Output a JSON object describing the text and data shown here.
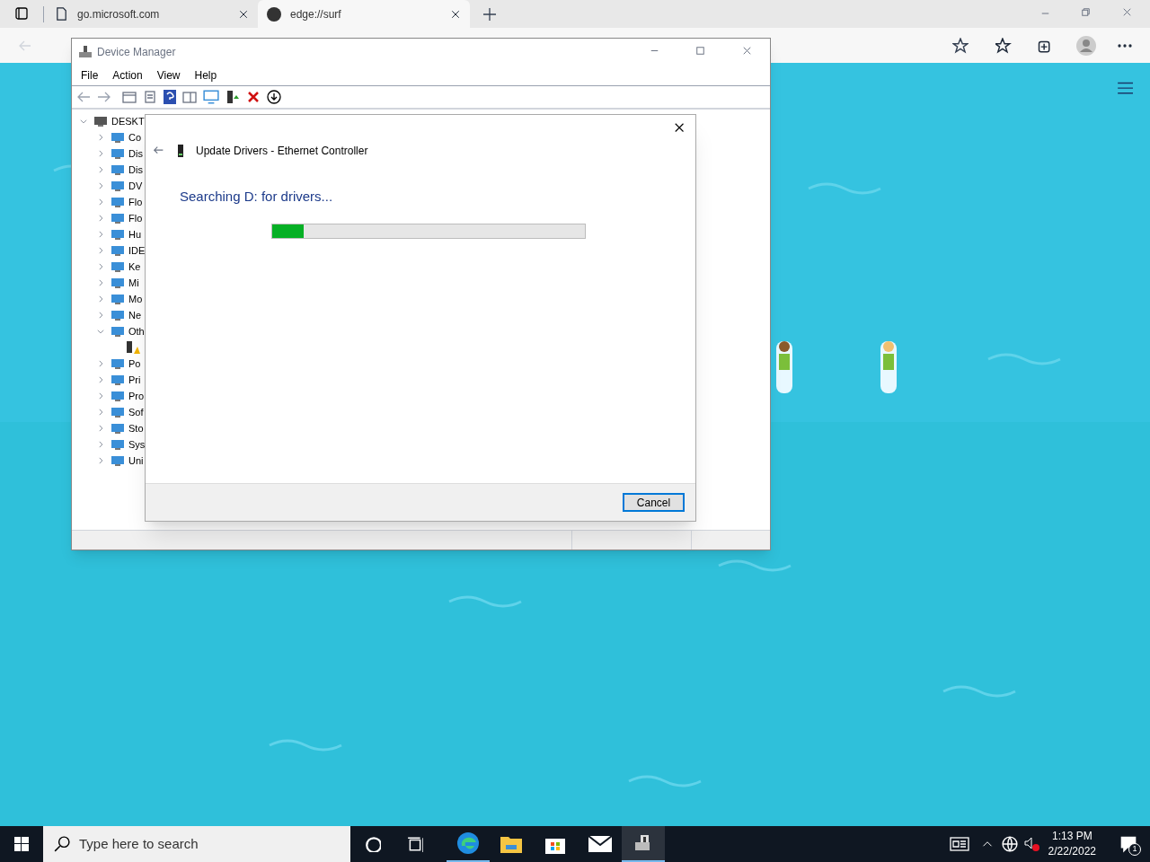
{
  "browser": {
    "tabs": [
      {
        "title": "go.microsoft.com",
        "selected": false
      },
      {
        "title": "edge://surf",
        "selected": true
      }
    ]
  },
  "device_manager": {
    "title": "Device Manager",
    "menu": [
      "File",
      "Action",
      "View",
      "Help"
    ],
    "tree": [
      {
        "label": "DESKT",
        "expanded": true,
        "children": [
          {
            "label": "Co",
            "expanded": false
          },
          {
            "label": "Dis",
            "expanded": false
          },
          {
            "label": "Dis",
            "expanded": false
          },
          {
            "label": "DV",
            "expanded": false
          },
          {
            "label": "Flo",
            "expanded": false
          },
          {
            "label": "Flo",
            "expanded": false
          },
          {
            "label": "Hu",
            "expanded": false
          },
          {
            "label": "IDE",
            "expanded": false
          },
          {
            "label": "Ke",
            "expanded": false
          },
          {
            "label": "Mi",
            "expanded": false
          },
          {
            "label": "Mo",
            "expanded": false
          },
          {
            "label": "Ne",
            "expanded": false
          },
          {
            "label": "Oth",
            "expanded": true,
            "children": [
              {
                "kind": "warning"
              }
            ]
          },
          {
            "label": "Po",
            "expanded": false
          },
          {
            "label": "Pri",
            "expanded": false
          },
          {
            "label": "Pro",
            "expanded": false
          },
          {
            "label": "Sof",
            "expanded": false
          },
          {
            "label": "Sto",
            "expanded": false
          },
          {
            "label": "Sys",
            "expanded": false
          },
          {
            "label": "Uni",
            "expanded": false
          }
        ]
      }
    ]
  },
  "dialog": {
    "title": "Update Drivers - Ethernet Controller",
    "status": "Searching D: for drivers...",
    "progress": {
      "level": 0.1
    },
    "buttons": [
      "Cancel"
    ]
  },
  "taskbar": {
    "search": {
      "placeholder": "Type here to search"
    },
    "time": "1:13 PM",
    "date": "2/22/2022",
    "notifications": "1"
  }
}
